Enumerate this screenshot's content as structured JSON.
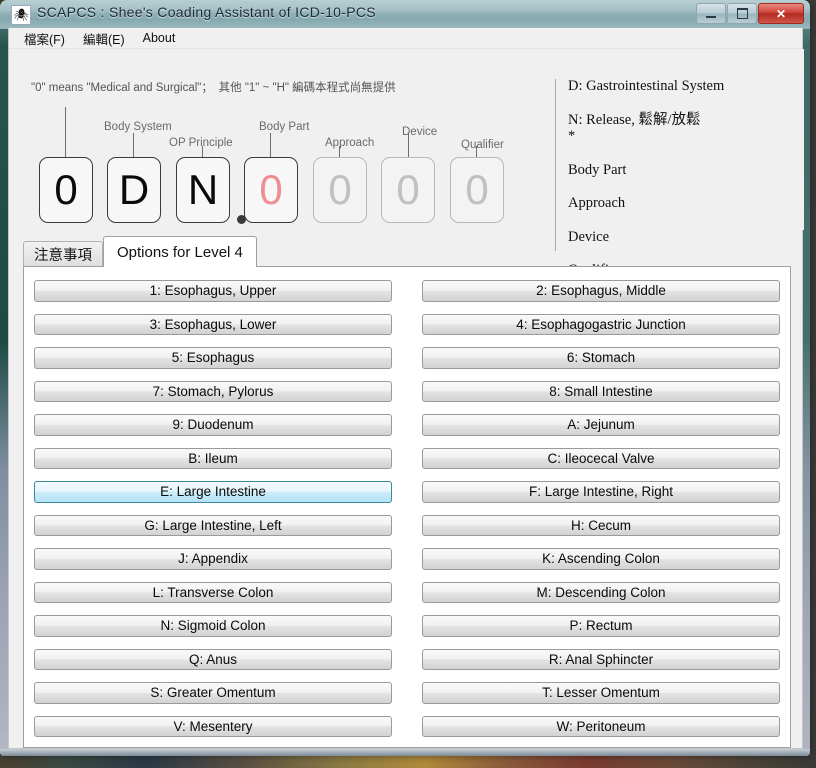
{
  "window": {
    "title": "SCAPCS : Shee's Coading Assistant of ICD-10-PCS",
    "icon": "app-spider-icon",
    "minimize_label": "–",
    "maximize_label": "□",
    "close_label": "✕"
  },
  "menu": {
    "items": [
      {
        "label": "檔案(F)"
      },
      {
        "label": "編輯(E)"
      },
      {
        "label": "About"
      }
    ]
  },
  "notice": {
    "text": "\"0\" means \"Medical and Surgical\"；　其他 \"1\" ~ \"H\" 編碼本程式尚無提供"
  },
  "code": {
    "boxes": [
      {
        "char": "0",
        "state": "filled",
        "label": ""
      },
      {
        "char": "D",
        "state": "filled",
        "label": "Body System"
      },
      {
        "char": "N",
        "state": "filled",
        "label": "OP Principle"
      },
      {
        "char": "0",
        "state": "pink",
        "label": "Body Part"
      },
      {
        "char": "0",
        "state": "empty",
        "label": "Approach"
      },
      {
        "char": "0",
        "state": "empty",
        "label": "Device"
      },
      {
        "char": "0",
        "state": "empty",
        "label": "Qualifier"
      }
    ],
    "separator_dot": "●",
    "colors": {
      "filled": "#0a0a0a",
      "pink": "#ef8e92",
      "empty": "#c0c0c0"
    }
  },
  "info_panel": {
    "lines": [
      "D: Gastrointestinal System",
      "N: Release, 鬆解/放鬆",
      "*",
      "Body Part",
      "Approach",
      "Device",
      "Qualifier"
    ]
  },
  "tabs": [
    {
      "label": "注意事項",
      "active": false
    },
    {
      "label": "Options for Level 4",
      "active": true
    }
  ],
  "options": {
    "left_column": [
      {
        "label": "1: Esophagus, Upper",
        "highlighted": false
      },
      {
        "label": "3: Esophagus, Lower",
        "highlighted": false
      },
      {
        "label": "5: Esophagus",
        "highlighted": false
      },
      {
        "label": "7: Stomach, Pylorus",
        "highlighted": false
      },
      {
        "label": "9: Duodenum",
        "highlighted": false
      },
      {
        "label": "B: Ileum",
        "highlighted": false
      },
      {
        "label": "E: Large Intestine",
        "highlighted": true
      },
      {
        "label": "G: Large Intestine, Left",
        "highlighted": false
      },
      {
        "label": "J: Appendix",
        "highlighted": false
      },
      {
        "label": "L: Transverse Colon",
        "highlighted": false
      },
      {
        "label": "N: Sigmoid Colon",
        "highlighted": false
      },
      {
        "label": "Q: Anus",
        "highlighted": false
      },
      {
        "label": "S: Greater Omentum",
        "highlighted": false
      },
      {
        "label": "V: Mesentery",
        "highlighted": false
      }
    ],
    "right_column": [
      {
        "label": "2: Esophagus, Middle",
        "highlighted": false
      },
      {
        "label": "4: Esophagogastric Junction",
        "highlighted": false
      },
      {
        "label": "6: Stomach",
        "highlighted": false
      },
      {
        "label": "8: Small Intestine",
        "highlighted": false
      },
      {
        "label": "A: Jejunum",
        "highlighted": false
      },
      {
        "label": "C: Ileocecal Valve",
        "highlighted": false
      },
      {
        "label": "F: Large Intestine, Right",
        "highlighted": false
      },
      {
        "label": "H: Cecum",
        "highlighted": false
      },
      {
        "label": "K: Ascending Colon",
        "highlighted": false
      },
      {
        "label": "M: Descending Colon",
        "highlighted": false
      },
      {
        "label": "P: Rectum",
        "highlighted": false
      },
      {
        "label": "R: Anal Sphincter",
        "highlighted": false
      },
      {
        "label": "T: Lesser Omentum",
        "highlighted": false
      },
      {
        "label": "W: Peritoneum",
        "highlighted": false
      }
    ],
    "highlight_color": "#b4e2f7"
  }
}
